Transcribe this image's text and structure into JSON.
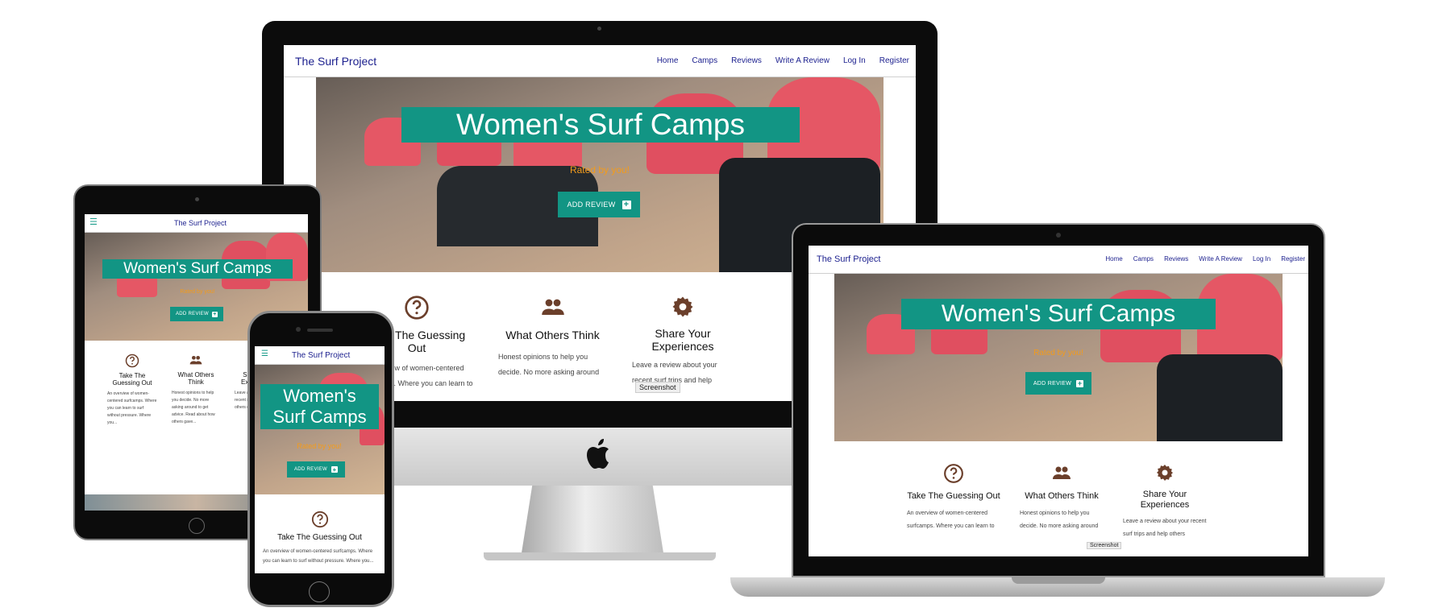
{
  "site": {
    "brand": "The Surf Project",
    "nav": [
      "Home",
      "Camps",
      "Reviews",
      "Write A Review",
      "Log In",
      "Register"
    ]
  },
  "hero": {
    "title": "Women's Surf Camps",
    "title_mobile_line1": "Women's",
    "title_mobile_line2": "Surf Camps",
    "subtitle": "Rated by you!",
    "cta": "ADD REVIEW"
  },
  "features": [
    {
      "icon": "question-circle-icon",
      "title": "Take The Guessing Out",
      "body": "An overview of women-centered surfcamps. Where you can learn to surf without pressure. Where you..."
    },
    {
      "icon": "people-icon",
      "title": "What Others Think",
      "body": "Honest opinions to help you decide. No more asking around to get advice. Read about how others gave..."
    },
    {
      "icon": "gear-icon",
      "title": "Share Your Experiences",
      "body": "Leave a review about your recent surf trips and help others decide..."
    }
  ],
  "tooltip": "Screenshot",
  "menu_icon": "hamburger-menu-icon",
  "colors": {
    "brand_teal": "#129584",
    "accent_orange": "#f39b1b",
    "nav_blue": "#1b1f8e",
    "icon_brown": "#6b3f2b"
  }
}
